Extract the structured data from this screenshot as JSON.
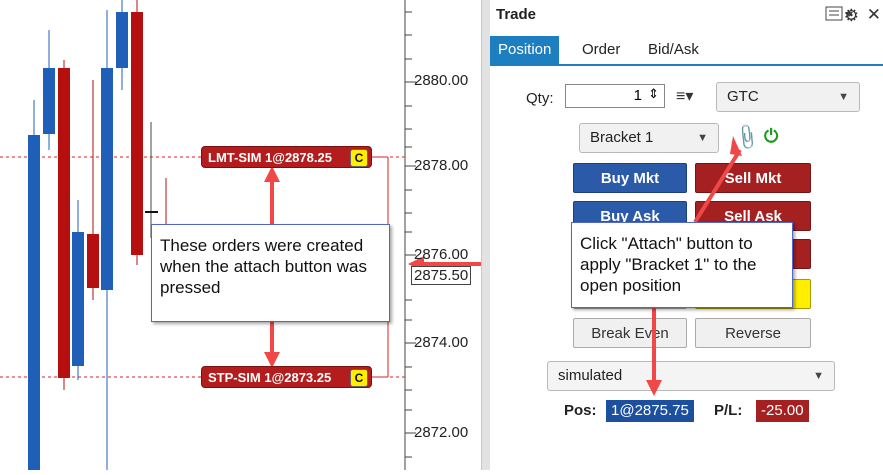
{
  "chart": {
    "price_labels": [
      "2880.00",
      "2878.00",
      "2876.00",
      "2875.50",
      "2874.00",
      "2872.00"
    ],
    "orders": [
      {
        "label": "LMT-SIM 1@2878.25",
        "flag": "C"
      },
      {
        "label": "STP-SIM 1@2873.25",
        "flag": "C"
      }
    ],
    "callout_text": "These orders were created when the attach button was pressed"
  },
  "panel": {
    "title": "Trade",
    "tabs": [
      {
        "label": "Position",
        "active": true
      },
      {
        "label": "Order",
        "active": false
      },
      {
        "label": "Bid/Ask",
        "active": false
      }
    ],
    "qty_label": "Qty:",
    "qty_value": "1",
    "tif_value": "GTC",
    "bracket_value": "Bracket 1",
    "buttons": {
      "buy_mkt": "Buy Mkt",
      "sell_mkt": "Sell Mkt",
      "buy_ask": "Buy Ask",
      "sell_ask": "Sell Ask",
      "break_even": "Break Even",
      "reverse": "Reverse"
    },
    "account_value": "simulated",
    "pos_label": "Pos:",
    "pos_value": "1@2875.75",
    "pl_label": "P/L:",
    "pl_value": "-25.00",
    "callout_text": "Click \"Attach\" button to apply \"Bracket 1\" to the open position"
  },
  "colors": {
    "accent": "#1e7fc0",
    "buy": "#2a5aa8",
    "sell": "#a52121",
    "arrow": "#f04848",
    "candle_up": "#1f5fb8",
    "candle_down": "#b50f0f"
  }
}
